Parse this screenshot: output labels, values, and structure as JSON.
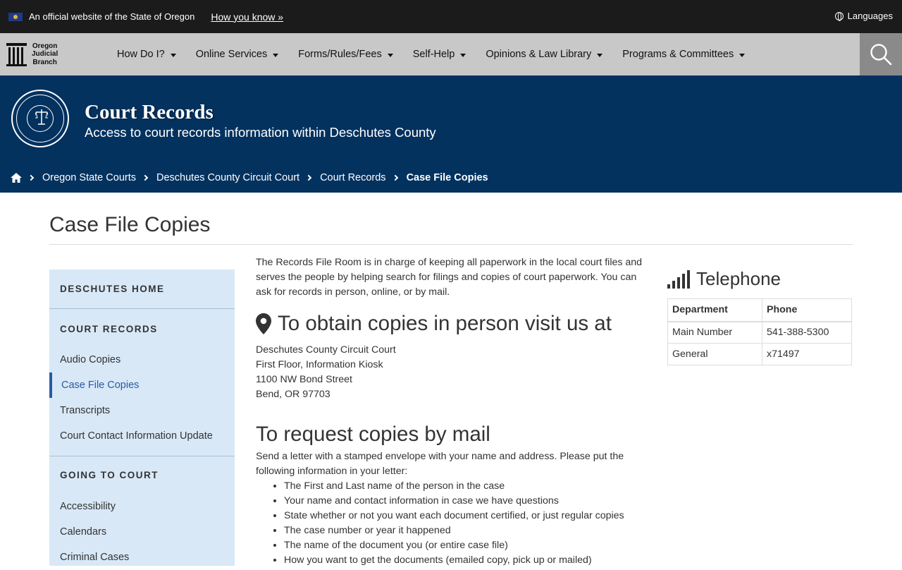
{
  "banner": {
    "official_text": "An official website of the State of Oregon",
    "how_you_know": "How you know »",
    "languages": "Languages"
  },
  "nav": {
    "logo_lines": [
      "Oregon",
      "Judicial",
      "Branch"
    ],
    "items": [
      {
        "label": "How Do I?"
      },
      {
        "label": "Online Services"
      },
      {
        "label": "Forms/Rules/Fees"
      },
      {
        "label": "Self-Help"
      },
      {
        "label": "Opinions & Law Library"
      },
      {
        "label": "Programs & Committees"
      }
    ]
  },
  "hero": {
    "title": "Court Records",
    "subtitle": "Access to court records information within Deschutes County"
  },
  "breadcrumb": {
    "items": [
      "Oregon State Courts",
      "Deschutes County Circuit Court",
      "Court Records"
    ],
    "current": "Case File Copies"
  },
  "page": {
    "title": "Case File Copies"
  },
  "sidebar": {
    "home": "Deschutes Home",
    "court_records": "Court Records",
    "court_records_links": [
      "Audio Copies",
      "Case File Copies",
      "Transcripts",
      "Court Contact Information Update"
    ],
    "going_to_court": "Going to Court",
    "going_to_court_links": [
      "Accessibility",
      "Calendars",
      "Criminal Cases"
    ]
  },
  "main": {
    "intro": "The Records File Room is in charge of keeping all paperwork in the local court files and serves the people by helping  search for  filings and copies of court paperwork. You can ask for records in person, online, or by mail.",
    "in_person_heading": "To obtain copies in person visit us at",
    "address": [
      "Deschutes County Circuit Court",
      "First Floor, Information Kiosk",
      "1100 NW Bond Street",
      "Bend, OR 97703"
    ],
    "mail_heading": "To request copies by mail",
    "mail_intro": "Send a letter with a stamped envelope with your name and address. Please put the following information in your letter:",
    "mail_list": [
      "The First and Last name of the person in the case",
      "Your name and contact information in case we have questions",
      "State whether or not you want each document certified, or just regular copies",
      "The case number or year it happened",
      "The name of the document you (or entire case file)",
      "How you want to get the documents (emailed copy, pick up or mailed)"
    ]
  },
  "telephone": {
    "heading": "Telephone",
    "col_department": "Department",
    "col_phone": "Phone",
    "rows": [
      {
        "department": "Main Number",
        "phone": "541-388-5300"
      },
      {
        "department": "General",
        "phone": "x71497"
      }
    ]
  },
  "colors": {
    "hero_bg": "#03325f",
    "nav_bg": "#c8c8c8",
    "sidebar_bg": "#d8e8f7",
    "active_link": "#2b5aa5"
  }
}
